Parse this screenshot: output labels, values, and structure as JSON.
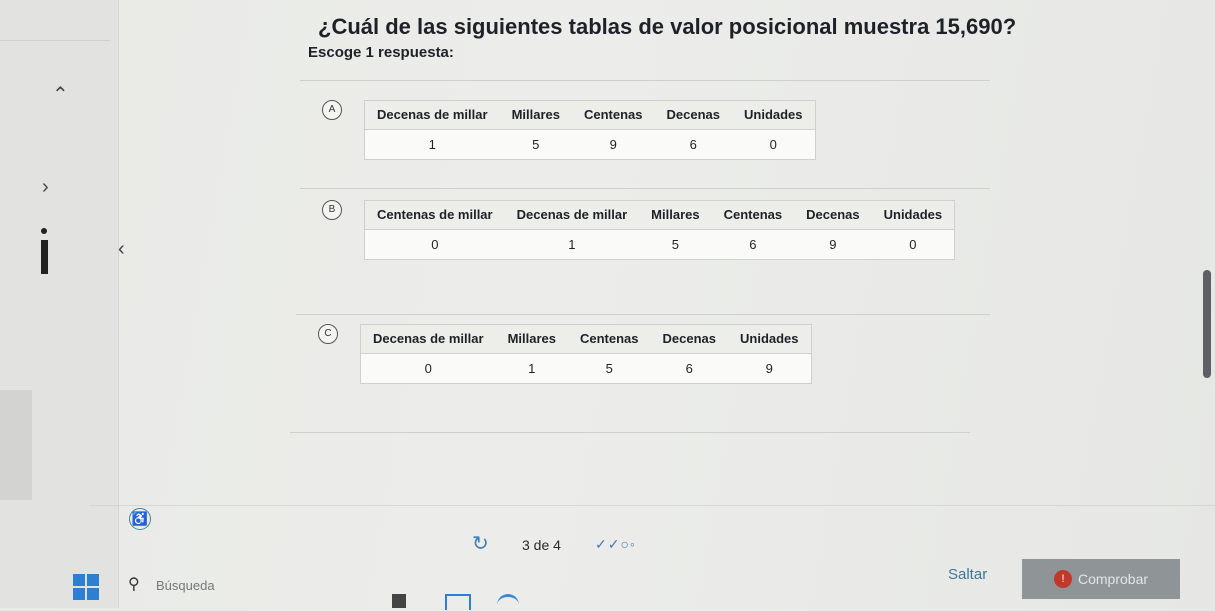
{
  "question": "¿Cuál de las siguientes tablas de valor posicional muestra 15,690?",
  "instruction": "Escoge 1 respuesta:",
  "options": [
    {
      "letter": "A",
      "headers": [
        "Decenas de millar",
        "Millares",
        "Centenas",
        "Decenas",
        "Unidades"
      ],
      "values": [
        "1",
        "5",
        "9",
        "6",
        "0"
      ]
    },
    {
      "letter": "B",
      "headers": [
        "Centenas de millar",
        "Decenas de millar",
        "Millares",
        "Centenas",
        "Decenas",
        "Unidades"
      ],
      "values": [
        "0",
        "1",
        "5",
        "6",
        "9",
        "0"
      ]
    },
    {
      "letter": "C",
      "headers": [
        "Decenas de millar",
        "Millares",
        "Centenas",
        "Decenas",
        "Unidades"
      ],
      "values": [
        "0",
        "1",
        "5",
        "6",
        "9"
      ]
    }
  ],
  "footer": {
    "progress": "3 de 4",
    "marks": "✓✓○◦",
    "skip_label": "Saltar",
    "check_label": "Comprobar"
  },
  "taskbar": {
    "search_placeholder": "Búsqueda"
  },
  "colors": {
    "accent": "#3d7894",
    "check_button": "#8f9497",
    "windows_blue": "#2d7fd3"
  }
}
